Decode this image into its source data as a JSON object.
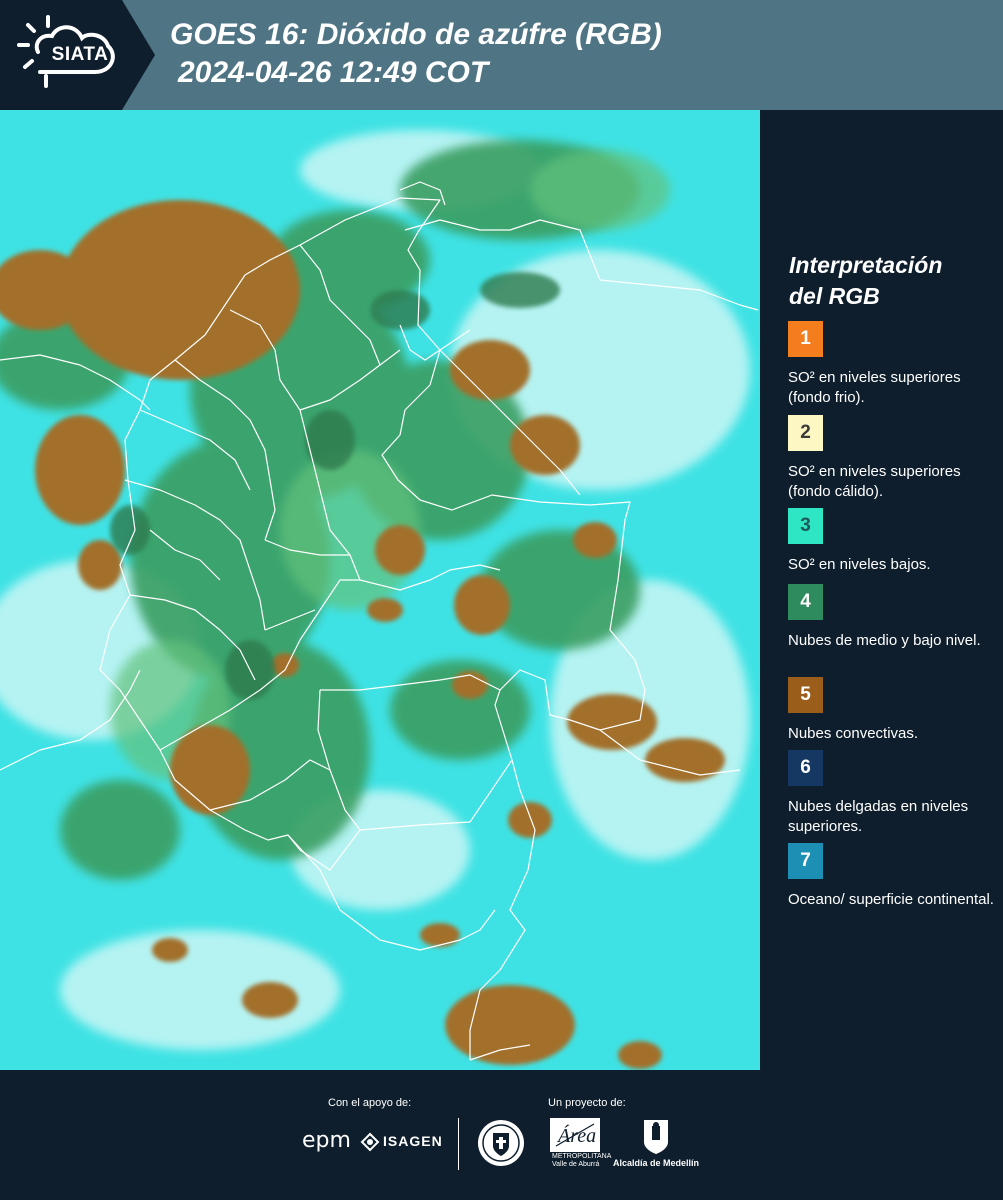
{
  "header": {
    "logo": "SIATA",
    "title_line1": "GOES 16: Dióxido de azúfre (RGB)",
    "title_line2": "2024-04-26 12:49 COT"
  },
  "map": {
    "background_color": "#38e3e6",
    "border_color": "#ffffff"
  },
  "legend": {
    "title_line1": "Interpretación",
    "title_line2": "del RGB",
    "items": [
      {
        "number": "1",
        "color": "#f47d1e",
        "text_color": "#ffffff",
        "label": "SO² en niveles superiores (fondo frio)."
      },
      {
        "number": "2",
        "color": "#fdf7c3",
        "text_color": "#3a3a3a",
        "label": "SO² en niveles superiores (fondo cálido)."
      },
      {
        "number": "3",
        "color": "#2ee6c4",
        "text_color": "#1d5a5a",
        "label": "SO² en niveles bajos."
      },
      {
        "number": "4",
        "color": "#2e8b5e",
        "text_color": "#ffffff",
        "label": "Nubes de medio y bajo nivel."
      },
      {
        "number": "5",
        "color": "#9a5e1a",
        "text_color": "#ffffff",
        "label": "Nubes convectivas."
      },
      {
        "number": "6",
        "color": "#143862",
        "text_color": "#ffffff",
        "label": "Nubes delgadas en niveles superiores."
      },
      {
        "number": "7",
        "color": "#1d8fb5",
        "text_color": "#ffffff",
        "label": "Oceano/ superficie continental."
      }
    ]
  },
  "footer": {
    "support_label": "Con el apoyo de:",
    "project_label": "Un proyecto de:",
    "sponsors": [
      "epm",
      "ISAGEN"
    ],
    "partners": [
      "Medellín",
      "Área Metropolitana",
      "Alcaldía de Medellín"
    ],
    "area_sub1": "METROPOLITANA",
    "area_sub2": "Valle de Aburrá",
    "alcaldia": "Alcaldía de Medellín",
    "epm": "epm",
    "isagen": "ISAGEN"
  }
}
